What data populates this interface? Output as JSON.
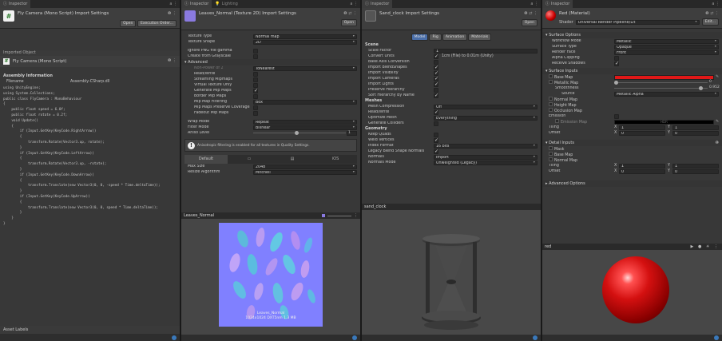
{
  "panel1": {
    "tab": "Inspector",
    "title": "Fly Camera (Mono Script) Import Settings",
    "open_button": "Open",
    "exec_button": "Execution Order...",
    "imported_object": "Imported Object",
    "script_title": "Fly Camera (Mono Script)",
    "assembly_info": "Assembly Information",
    "filename_label": "Filename",
    "filename_value": "Assembly-CSharp.dll",
    "code": [
      "using UnityEngine;",
      "using System.Collections;",
      "",
      "public class FlyCamera : MonoBehaviour",
      "{",
      "    public float speed = 6.0f;",
      "    public float rotate = 0.2f;",
      "",
      "    void Update()",
      "    {",
      "        if (Input.GetKey(KeyCode.RightArrow))",
      "        {",
      "            transform.Rotate(Vector3.up, rotate);",
      "        }",
      "        if (Input.GetKey(KeyCode.LeftArrow))",
      "        {",
      "            transform.Rotate(Vector3.up, -rotate);",
      "        }",
      "        if (Input.GetKey(KeyCode.DownArrow))",
      "        {",
      "            transform.Translate(new Vector3(0, 0, -speed * Time.deltaTime));",
      "        }",
      "        if (Input.GetKey(KeyCode.UpArrow))",
      "        {",
      "            transform.Translate(new Vector3(0, 0, speed * Time.deltaTime));",
      "        }",
      "    }",
      "}"
    ],
    "footer": "Asset Labels"
  },
  "panel2": {
    "tab1": "Inspector",
    "tab2": "Lighting",
    "title": "Leaves_Normal (Texture 2D) Import Settings",
    "open_button": "Open",
    "rows": [
      {
        "label": "Texture Type",
        "value": "Normal map",
        "kind": "dd"
      },
      {
        "label": "Texture Shape",
        "value": "2D",
        "kind": "dd"
      },
      {
        "label": "",
        "value": "",
        "kind": "gap"
      },
      {
        "label": "Ignore PNG file gamma",
        "value": "",
        "kind": "chk"
      },
      {
        "label": "Create from Grayscale",
        "value": "",
        "kind": "chk"
      }
    ],
    "advanced": "Advanced",
    "adv_rows": [
      {
        "label": "Non-Power of 2",
        "value": "ToNearest",
        "kind": "dd"
      },
      {
        "label": "Read/Write",
        "value": "",
        "kind": "chk"
      },
      {
        "label": "Streaming Mipmaps",
        "value": "",
        "kind": "chk"
      },
      {
        "label": "Virtual Texture Only",
        "value": "",
        "kind": "chk"
      },
      {
        "label": "Generate Mip Maps",
        "value": "",
        "kind": "chkon"
      },
      {
        "label": "Border Mip Maps",
        "value": "",
        "kind": "chk"
      },
      {
        "label": "Mip Map Filtering",
        "value": "Box",
        "kind": "dd"
      },
      {
        "label": "Mip Maps Preserve Coverage",
        "value": "",
        "kind": "chk"
      },
      {
        "label": "Fadeout Mip Maps",
        "value": "",
        "kind": "chk"
      }
    ],
    "wrap_rows": [
      {
        "label": "Wrap Mode",
        "value": "Repeat",
        "kind": "dd"
      },
      {
        "label": "Filter Mode",
        "value": "Bilinear",
        "kind": "dd"
      }
    ],
    "aniso_label": "Aniso Level",
    "aniso_value": "1",
    "warning": "Anisotropic filtering is enabled for all textures in Quality Settings.",
    "platform_tab": "Default",
    "max_size_label": "Max Size",
    "max_size_value": "2048",
    "resize_label": "Resize Algorithm",
    "resize_value": "Mitchell",
    "preview_title": "Leaves_Normal",
    "preview_caption1": "Leaves_Normal",
    "preview_caption2": "1024x1024  DXT5nm  1.3 MB"
  },
  "panel3": {
    "tab": "Inspector",
    "title": "Sand_clock Import Settings",
    "open_button": "Open",
    "tabs": [
      "Model",
      "Rig",
      "Animation",
      "Materials"
    ],
    "scene": "Scene",
    "rows": [
      {
        "label": "Scale Factor",
        "value": "1",
        "kind": "txt"
      },
      {
        "label": "Convert Units",
        "value": "1cm (File) to 0.01m (Unity)",
        "kind": "chkon"
      },
      {
        "label": "Bake Axis Conversion",
        "value": "",
        "kind": "chk"
      },
      {
        "label": "Import BlendShapes",
        "value": "",
        "kind": "chkon"
      },
      {
        "label": "Import Visibility",
        "value": "",
        "kind": "chkon"
      },
      {
        "label": "Import Cameras",
        "value": "",
        "kind": "chkon"
      },
      {
        "label": "Import Lights",
        "value": "",
        "kind": "chkon"
      },
      {
        "label": "Preserve Hierarchy",
        "value": "",
        "kind": "chk"
      },
      {
        "label": "Sort Hierarchy By Name",
        "value": "",
        "kind": "chkon"
      }
    ],
    "meshes": "Meshes",
    "mesh_rows": [
      {
        "label": "Mesh Compression",
        "value": "Off",
        "kind": "dd"
      },
      {
        "label": "Read/Write",
        "value": "",
        "kind": "chkon"
      },
      {
        "label": "Optimize Mesh",
        "value": "Everything",
        "kind": "dd"
      },
      {
        "label": "Generate Colliders",
        "value": "",
        "kind": "chk"
      }
    ],
    "geometry": "Geometry",
    "geo_rows": [
      {
        "label": "Keep Quads",
        "value": "",
        "kind": "chk"
      },
      {
        "label": "Weld Vertices",
        "value": "",
        "kind": "chkon"
      },
      {
        "label": "Index Format",
        "value": "16 bits",
        "kind": "dd"
      },
      {
        "label": "Legacy Blend Shape Normals",
        "value": "",
        "kind": "chkon"
      },
      {
        "label": "Normals",
        "value": "Import",
        "kind": "dd"
      },
      {
        "label": "Normals Mode",
        "value": "Unweighted (Legacy)",
        "kind": "dd"
      }
    ],
    "preview_title": "sand_clock"
  },
  "panel4": {
    "tab": "Inspector",
    "title": "Red (Material)",
    "shader_label": "Shader",
    "shader_value": "Universal Render Pipeline/Lit",
    "edit_button": "Edit...",
    "surface_options": "Surface Options",
    "so_rows": [
      {
        "label": "Workflow Mode",
        "value": "Metallic",
        "kind": "dd"
      },
      {
        "label": "Surface Type",
        "value": "Opaque",
        "kind": "dd"
      },
      {
        "label": "Render Face",
        "value": "Front",
        "kind": "dd"
      },
      {
        "label": "Alpha Clipping",
        "value": "",
        "kind": "chk"
      },
      {
        "label": "Receive Shadows",
        "value": "",
        "kind": "chkon"
      }
    ],
    "surface_inputs": "Surface Inputs",
    "base_map": "Base Map",
    "metallic_map": "Metallic Map",
    "metallic_value": "0",
    "metallic_level": 0.0,
    "smoothness": "Smoothness",
    "smoothness_value": "0.952",
    "smoothness_level": 0.952,
    "source_label": "Source",
    "source_value": "Metallic Alpha",
    "normal_map": "Normal Map",
    "height_map": "Height Map",
    "occlusion_map": "Occlusion Map",
    "emission": "Emission",
    "emission_map": "Emission Map",
    "emission_hdr": "HDR",
    "tiling": "Tiling",
    "offset": "Offset",
    "x_label": "X",
    "y_label": "Y",
    "tiling_x": "1",
    "tiling_y": "1",
    "offset_x": "0",
    "offset_y": "0",
    "detail_inputs": "Detail Inputs",
    "mask": "Mask",
    "detail_base": "Base Map",
    "detail_normal": "Normal Map",
    "tiling2_x": "1",
    "tiling2_y": "1",
    "offset2_x": "0",
    "offset2_y": "0",
    "advanced": "Advanced Options",
    "preview_title": "red",
    "base_color": "#e01818"
  }
}
